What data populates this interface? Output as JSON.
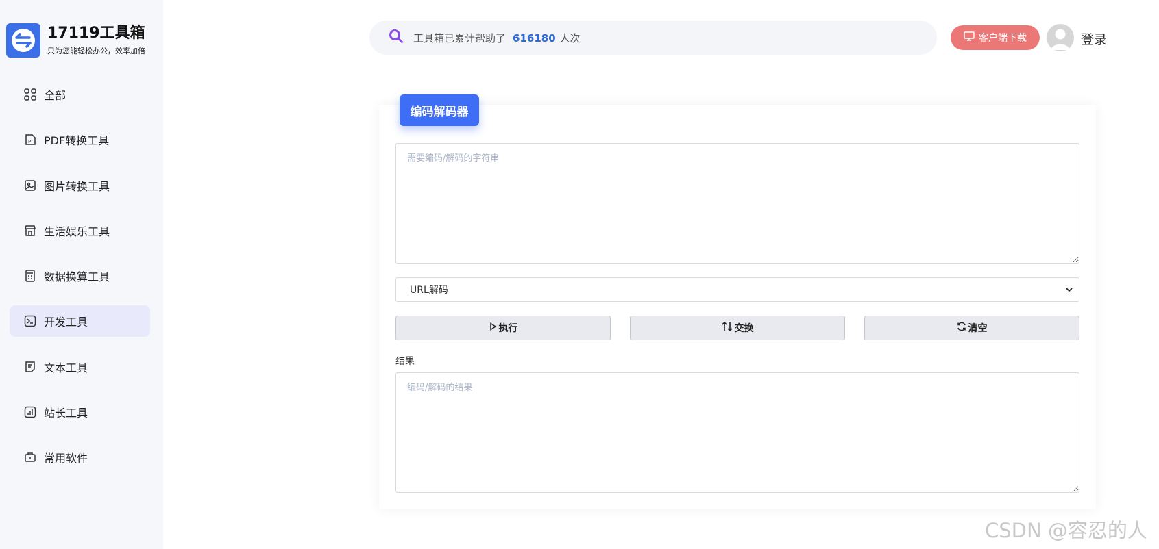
{
  "logo": {
    "title": "17119工具箱",
    "subtitle": "只为您能轻松办公，效率加倍",
    "icon": "swap-arrows-icon",
    "color": "#3b6fe8"
  },
  "sidebar": {
    "items": [
      {
        "label": "全部",
        "icon": "grid-icon",
        "active": false
      },
      {
        "label": "PDF转换工具",
        "icon": "pdf-icon",
        "active": false
      },
      {
        "label": "图片转换工具",
        "icon": "image-icon",
        "active": false
      },
      {
        "label": "生活娱乐工具",
        "icon": "store-icon",
        "active": false
      },
      {
        "label": "数据换算工具",
        "icon": "calculator-icon",
        "active": false
      },
      {
        "label": "开发工具",
        "icon": "terminal-icon",
        "active": true
      },
      {
        "label": "文本工具",
        "icon": "document-icon",
        "active": false
      },
      {
        "label": "站长工具",
        "icon": "chart-icon",
        "active": false
      },
      {
        "label": "常用软件",
        "icon": "briefcase-icon",
        "active": false
      }
    ]
  },
  "header": {
    "search_prefix": "工具箱已累计帮助了",
    "search_count": "616180",
    "search_suffix": "人次",
    "download_label": "客户端下载",
    "login_label": "登录"
  },
  "tool": {
    "tab_label": "编码解码器",
    "input_placeholder": "需要编码/解码的字符串",
    "mode_selected": "URL解码",
    "buttons": {
      "run": "执行",
      "swap": "交换",
      "clear": "清空"
    },
    "result_label": "结果",
    "output_placeholder": "编码/解码的结果"
  },
  "watermark": "CSDN @容忍的人",
  "colors": {
    "accent": "#3d6ef5",
    "download": "#ec7777",
    "active_nav": "#e8e9fb",
    "count": "#2b6ad8"
  }
}
